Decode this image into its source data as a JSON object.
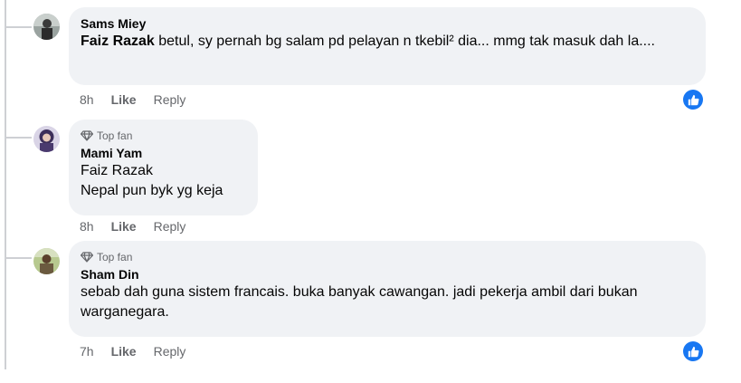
{
  "comments": [
    {
      "author": "Sams Miey",
      "mention": "Faiz Razak",
      "text": " betul, sy pernah bg salam pd pelayan n tkebil² dia... mmg tak masuk dah la....",
      "time": "8h",
      "like_label": "Like",
      "reply_label": "Reply",
      "reaction": "like-reaction-icon"
    },
    {
      "badge": "Top fan",
      "author": "Mami Yam",
      "mention": "Faiz Razak",
      "text": "Nepal pun byk yg keja",
      "time": "8h",
      "like_label": "Like",
      "reply_label": "Reply"
    },
    {
      "badge": "Top fan",
      "author": "Sham Din",
      "text": "sebab dah guna sistem francais. buka banyak cawangan. jadi pekerja ambil dari bukan warganegara.",
      "time": "7h",
      "like_label": "Like",
      "reply_label": "Reply",
      "reaction": "like-reaction-icon"
    }
  ],
  "colors": {
    "bubble": "#f0f2f5",
    "meta": "#65676b",
    "reaction": "#1877f2"
  }
}
